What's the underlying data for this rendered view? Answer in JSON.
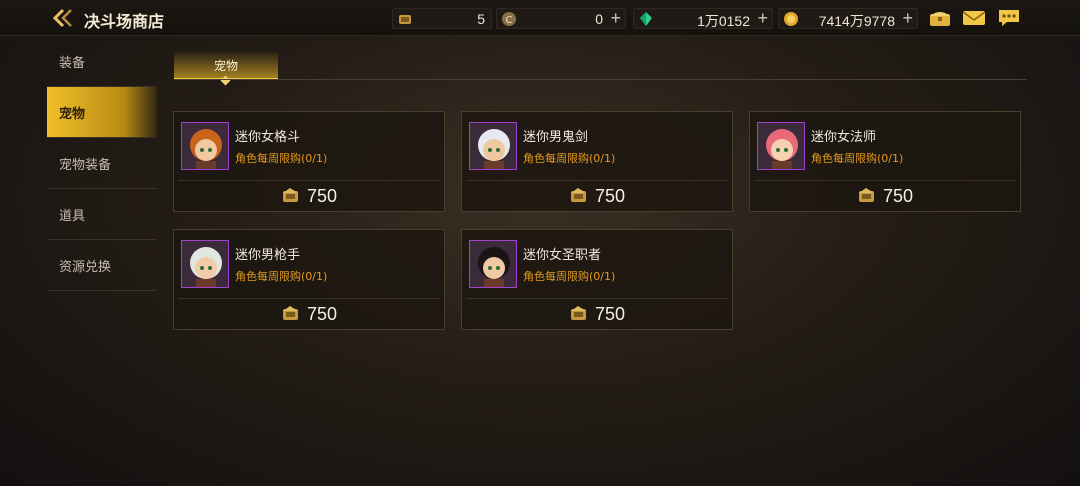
{
  "header": {
    "title": "决斗场商店",
    "resources": [
      {
        "icon": "duel-coin-icon",
        "value": "5",
        "has_plus": false
      },
      {
        "icon": "c-currency-icon",
        "value": "0",
        "has_plus": true
      },
      {
        "icon": "green-gem-icon",
        "value": "1万0152",
        "has_plus": true
      },
      {
        "icon": "gold-coin-icon",
        "value": "7414万9778",
        "has_plus": true
      }
    ]
  },
  "sidebar": {
    "items": [
      {
        "label": "装备",
        "active": false
      },
      {
        "label": "宠物",
        "active": true
      },
      {
        "label": "宠物装备",
        "active": false
      },
      {
        "label": "道具",
        "active": false
      },
      {
        "label": "资源兑换",
        "active": false
      }
    ]
  },
  "tabs": [
    {
      "label": "宠物",
      "active": true
    }
  ],
  "products": [
    {
      "name": "迷你女格斗",
      "limit": "角色每周限购(0/1)",
      "price": "750",
      "hair": "#c8641c",
      "skin": "#f2c8a0"
    },
    {
      "name": "迷你男鬼剑",
      "limit": "角色每周限购(0/1)",
      "price": "750",
      "hair": "#e8e8f0",
      "skin": "#f0c8a0"
    },
    {
      "name": "迷你女法师",
      "limit": "角色每周限购(0/1)",
      "price": "750",
      "hair": "#e86a7a",
      "skin": "#f6d0b0"
    },
    {
      "name": "迷你男枪手",
      "limit": "角色每周限购(0/1)",
      "price": "750",
      "hair": "#e0e6e0",
      "skin": "#f2cca8"
    },
    {
      "name": "迷你女圣职者",
      "limit": "角色每周限购(0/1)",
      "price": "750",
      "hair": "#1a1414",
      "skin": "#f0c8a4"
    }
  ],
  "colors": {
    "accent": "#f0c02a",
    "limit_text": "#e39a1e",
    "portrait_border": "#a040d0"
  }
}
